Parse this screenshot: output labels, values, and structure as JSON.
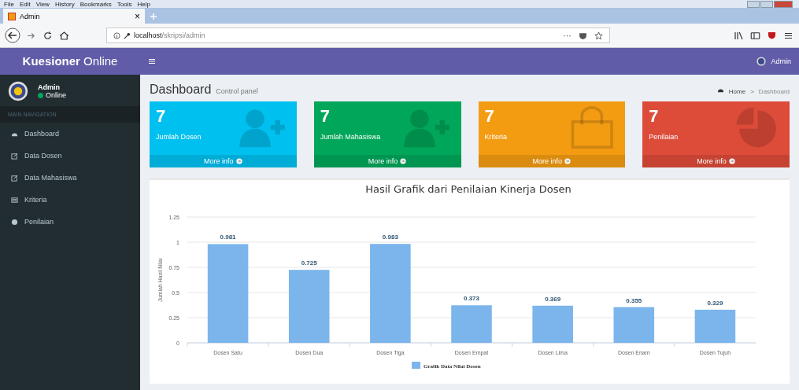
{
  "browser": {
    "menu": [
      "File",
      "Edit",
      "View",
      "History",
      "Bookmarks",
      "Tools",
      "Help"
    ],
    "tab": {
      "title": "Admin",
      "close": "×"
    },
    "url": {
      "host": "localhost",
      "path": "/skripsi/admin"
    },
    "url_more": "···"
  },
  "brand": "**Kuesioner** Online",
  "user": {
    "name": "Admin",
    "status": "Online",
    "online": true
  },
  "nav_header": "MAIN NAVIGATION",
  "sidebar": {
    "items": [
      {
        "label": "Dashboard"
      },
      {
        "label": "Data Dosen"
      },
      {
        "label": "Data Mahasiswa"
      },
      {
        "label": "Kriteria"
      },
      {
        "label": "Penilaian"
      }
    ]
  },
  "header": {
    "user": "Admin"
  },
  "page": {
    "title": "Dashboard",
    "subtitle": "Control panel",
    "breadcrumb": [
      "Home",
      "Dashboard"
    ],
    "breadcrumb_separator": ">"
  },
  "boxes": [
    {
      "value": "7",
      "label": "Jumlah Dosen",
      "link": "More info",
      "color": "#00c0ef"
    },
    {
      "value": "7",
      "label": "Jumlah Mahasiswa",
      "link": "More info",
      "color": "#00a65a"
    },
    {
      "value": "7",
      "label": "Kriteria",
      "link": "More info",
      "color": "#f39c12"
    },
    {
      "value": "7",
      "label": "Penilaian",
      "link": "More info",
      "color": "#dd4b39"
    }
  ],
  "chart": {
    "chart_data": {
      "type": "bar",
      "title": "Hasil Grafik dari Penilaian Kinerja Dosen",
      "ylabel": "Jumlah Hasil Nilai",
      "categories": [
        "Dosen Satu",
        "Dosen Dua",
        "Dosen Tiga",
        "Dosen Empat",
        "Dosen Lima",
        "Dosen Enam",
        "Dosen Tujuh"
      ],
      "series": [
        {
          "name": "Grafik Data Nilai Dosen",
          "color": "#7cb5ec",
          "values": [
            0.981,
            0.725,
            0.983,
            0.373,
            0.369,
            0.355,
            0.329
          ]
        }
      ],
      "ylim": [
        0,
        1.25
      ],
      "yticks": [
        {
          "value": 0,
          "label": "0"
        },
        {
          "value": 0.25,
          "label": "0.25"
        },
        {
          "value": 0.5,
          "label": "0.5"
        },
        {
          "value": 0.75,
          "label": "0.75"
        },
        {
          "value": 1,
          "label": "1"
        },
        {
          "value": 1.25,
          "label": "1.25"
        }
      ],
      "data_labels": true,
      "grid": true
    }
  }
}
